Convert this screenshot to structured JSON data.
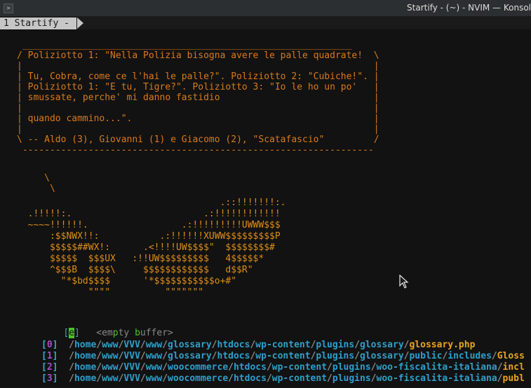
{
  "window": {
    "title": "Startify - (~) - NVIM — Konsol",
    "app_icon": "terminal-icon",
    "app_icon_glyph": ">"
  },
  "tabline": {
    "tab_label": "1 Startify -"
  },
  "quote_box": {
    "top": " ____________________________________________________________",
    "lines": [
      "/ Poliziotto 1: \"Nella Polizia bisogna avere le palle quadrate!  \\",
      "|                                                                |",
      "| Tu, Cobra, come ce l'hai le palle?\". Poliziotto 2: \"Cubiche!\". |",
      "| Poliziotto 1: \"E tu, Tigre?\". Poliziotto 3: \"Io le ho un po'   |",
      "| smussate, perche' mi danno fastidio                            |",
      "|                                                                |",
      "| quando cammino...\".                                            |",
      "|                                                                |",
      "\\ -- Aldo (3), Giovanni (1) e Giacomo (2), \"Scatafascio\"         /",
      " ----------------------------------------------------------------"
    ],
    "tail": [
      "     \\",
      "      \\"
    ]
  },
  "ascii_art": [
    "                                     .::!!!!!!!:.",
    "  .!!!!!:.                        .:!!!!!!!!!!!!",
    "  ~~~~!!!!!!.                 .:!!!!!!!!!UWWW$$$",
    "      :$$NWX!!:           .:!!!!!!XUWW$$$$$$$$$P",
    "      $$$$$##WX!:      .<!!!!UW$$$$\"  $$$$$$$$#",
    "      $$$$$  $$$UX   :!!UW$$$$$$$$$   4$$$$$*",
    "      ^$$$B  $$$$\\     $$$$$$$$$$$$   d$$R\"",
    "        \"*$bd$$$$      '*$$$$$$$$$$$o+#\"",
    "             \"\"\"\"          \"\"\"\"\"\"\""
  ],
  "empty_buffer": {
    "index": "e",
    "label_parts": [
      "<",
      "em",
      "p",
      "ty ",
      "b",
      "uffer>"
    ]
  },
  "mru_files": [
    {
      "index": "0",
      "dirs": [
        "home",
        "www",
        "VVV",
        "www",
        "glossary",
        "htdocs",
        "wp-content",
        "plugins",
        "glossary"
      ],
      "file": "glossary.php"
    },
    {
      "index": "1",
      "dirs": [
        "home",
        "www",
        "VVV",
        "www",
        "glossary",
        "htdocs",
        "wp-content",
        "plugins",
        "glossary",
        "public",
        "includes"
      ],
      "file": "Gloss"
    },
    {
      "index": "2",
      "dirs": [
        "home",
        "www",
        "VVV",
        "www",
        "woocommerce",
        "htdocs",
        "wp-content",
        "plugins",
        "woo-fiscalita-italiana"
      ],
      "file": "incl"
    },
    {
      "index": "3",
      "dirs": [
        "home",
        "www",
        "VVV",
        "www",
        "woocommerce",
        "htdocs",
        "wp-content",
        "plugins",
        "woo-fiscalita-italiana"
      ],
      "file": "publ"
    }
  ],
  "colors": {
    "background": "#121212",
    "quote": "#d97a1c",
    "ascii": "#dd8d18",
    "bracket": "#3aa8c6",
    "index": "#a34dc8",
    "path": "#2f9fcb",
    "filename": "#e8a520",
    "cursor": "#4ec227"
  }
}
